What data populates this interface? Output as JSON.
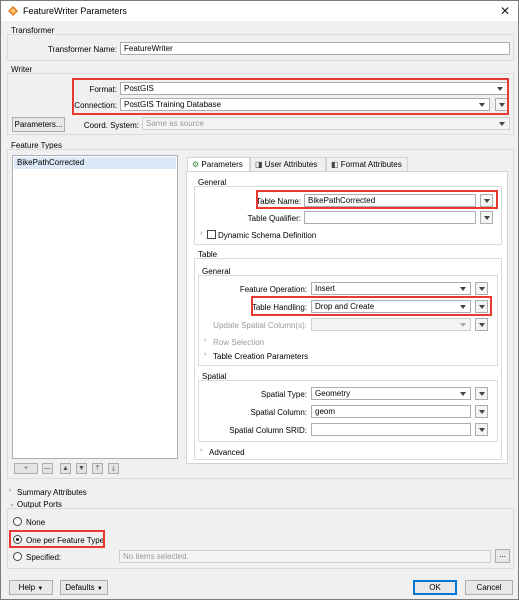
{
  "window": {
    "title": "FeatureWriter Parameters"
  },
  "transformer": {
    "section_label": "Transformer",
    "name_label": "Transformer Name:",
    "name_value": "FeatureWriter"
  },
  "writer": {
    "section_label": "Writer",
    "format_label": "Format:",
    "format_value": "PostGIS",
    "connection_label": "Connection:",
    "connection_value": "PostGIS Training Database",
    "parameters_button": "Parameters...",
    "coord_label": "Coord. System:",
    "coord_value": "Same as source"
  },
  "feature_types": {
    "section_label": "Feature Types",
    "items": [
      "BikePathCorrected"
    ],
    "toolbar": {
      "add": "+",
      "remove": "—",
      "up": "▲",
      "down": "▼",
      "top": "⤒",
      "bottom": "⤓"
    }
  },
  "tabs": [
    {
      "label": "Parameters",
      "active": true
    },
    {
      "label": "User Attributes",
      "active": false
    },
    {
      "label": "Format Attributes",
      "active": false
    }
  ],
  "general": {
    "section_label": "General",
    "table_name_label": "Table Name:",
    "table_name_value": "BikePathCorrected",
    "table_qualifier_label": "Table Qualifier:",
    "table_qualifier_value": "",
    "dynamic_schema_label": "Dynamic Schema Definition"
  },
  "table": {
    "section_label": "Table",
    "general_label": "General",
    "feature_operation_label": "Feature Operation:",
    "feature_operation_value": "Insert",
    "table_handling_label": "Table Handling:",
    "table_handling_value": "Drop and Create",
    "update_spatial_label": "Update Spatial Column(s):",
    "update_spatial_value": "",
    "row_selection_label": "Row Selection",
    "table_creation_label": "Table Creation Parameters",
    "spatial_label": "Spatial",
    "spatial_type_label": "Spatial Type:",
    "spatial_type_value": "Geometry",
    "spatial_column_label": "Spatial Column:",
    "spatial_column_value": "geom",
    "spatial_srid_label": "Spatial Column SRID:",
    "spatial_srid_value": "",
    "advanced_label": "Advanced"
  },
  "summary": {
    "label": "Summary Attributes"
  },
  "output_ports": {
    "label": "Output Ports",
    "options": [
      {
        "label": "None",
        "selected": false
      },
      {
        "label": "One per Feature Type",
        "selected": true
      },
      {
        "label": "Specified:",
        "selected": false
      }
    ],
    "specified_placeholder": "No items selected.",
    "browse": "..."
  },
  "footer": {
    "help": "Help",
    "defaults": "Defaults",
    "ok": "OK",
    "cancel": "Cancel"
  },
  "colors": {
    "highlight": "#e8382f",
    "window_bg": "#f0f0f0",
    "ok_border": "#0078d7"
  }
}
